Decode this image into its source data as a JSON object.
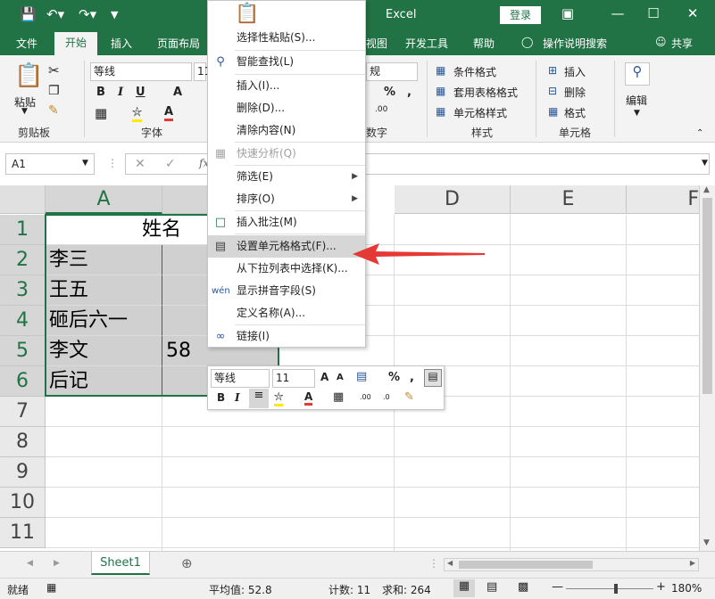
{
  "titlebar": {
    "app_title": "Excel",
    "login_label": "登录",
    "save_icon": "save-icon",
    "undo_icon": "undo-icon",
    "redo_icon": "redo-icon"
  },
  "ribbon_tabs": [
    "文件",
    "开始",
    "插入",
    "页面布局",
    "视图",
    "开发工具",
    "帮助",
    "操作说明搜索",
    "共享"
  ],
  "ribbon": {
    "paste_label": "粘贴",
    "clipboard_group": "剪贴板",
    "font_group": "字体",
    "font_name": "等线",
    "font_size": "11",
    "number_group": "数字",
    "number_format": "规",
    "styles_group": "样式",
    "conditional_format": "条件格式",
    "table_format": "套用表格格式",
    "cell_styles": "单元格样式",
    "cells_group": "单元格",
    "insert_label": "插入",
    "delete_label": "删除",
    "format_label": "格式",
    "edit_label": "编辑"
  },
  "formula_bar": {
    "name_box": "A1",
    "fx": "fx"
  },
  "columns": [
    "A",
    "D",
    "E",
    "F"
  ],
  "rows": [
    "1",
    "2",
    "3",
    "4",
    "5",
    "6",
    "7",
    "8",
    "9",
    "10",
    "11"
  ],
  "cells": {
    "a1": "姓名",
    "a2": "李三",
    "a3": "王五",
    "a4": "砸后六一",
    "a5": "李文",
    "a6": "后记",
    "b5": "58"
  },
  "context_menu": {
    "paste_special": "选择性粘贴(S)...",
    "smart_lookup": "智能查找(L)",
    "insert": "插入(I)...",
    "delete": "删除(D)...",
    "clear_contents": "清除内容(N)",
    "quick_analysis": "快速分析(Q)",
    "filter": "筛选(E)",
    "sort": "排序(O)",
    "insert_comment": "插入批注(M)",
    "format_cells": "设置单元格格式(F)...",
    "pick_from_list": "从下拉列表中选择(K)...",
    "phonetic": "显示拼音字段(S)",
    "define_name": "定义名称(A)...",
    "link": "链接(I)"
  },
  "mini_toolbar": {
    "font_name": "等线",
    "font_size": "11",
    "percent": "%",
    "comma": ","
  },
  "sheet_tabs": [
    "Sheet1"
  ],
  "status": {
    "ready": "就绪",
    "average": "平均值: 52.8",
    "count": "计数: 11",
    "sum": "求和: 264",
    "zoom": "180%"
  },
  "colors": {
    "brand_green": "#217346",
    "selection_gray": "#d0d0d0",
    "arrow_red": "#e53935"
  }
}
